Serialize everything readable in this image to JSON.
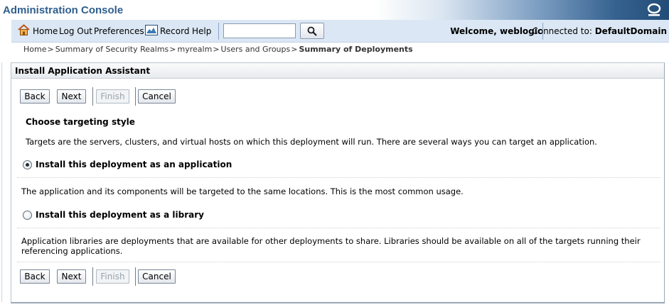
{
  "window": {
    "title": "Administration Console",
    "brand_icon": "oracle-logo-icon"
  },
  "toolbar": {
    "home": "Home",
    "logout": "Log Out",
    "preferences": "Preferences",
    "record": "Record",
    "help": "Help",
    "search_value": "",
    "welcome": "Welcome, weblogic",
    "connected_label": "Connected to:",
    "domain": "DefaultDomain"
  },
  "breadcrumb": {
    "items": [
      "Home",
      "Summary of Security Realms",
      "myrealm",
      "Users and Groups"
    ],
    "separator": ">",
    "current": "Summary of Deployments"
  },
  "panel": {
    "title": "Install Application Assistant",
    "buttons": {
      "back": "Back",
      "next": "Next",
      "finish": "Finish",
      "cancel": "Cancel"
    },
    "section_title": "Choose targeting style",
    "intro": "Targets are the servers, clusters, and virtual hosts on which this deployment will run. There are several ways you can target an application.",
    "options": [
      {
        "label": "Install this deployment as an application",
        "selected": true,
        "description": "The application and its components will be targeted to the same locations. This is the most common usage."
      },
      {
        "label": "Install this deployment as a library",
        "selected": false,
        "description": "Application libraries are deployments that are available for other deployments to share. Libraries should be available on all of the targets running their referencing applications."
      }
    ]
  },
  "colors": {
    "title_text": "#2f5e8e",
    "toolbar_bg": "#dbe7f4",
    "panel_border": "#b9c4cf"
  }
}
